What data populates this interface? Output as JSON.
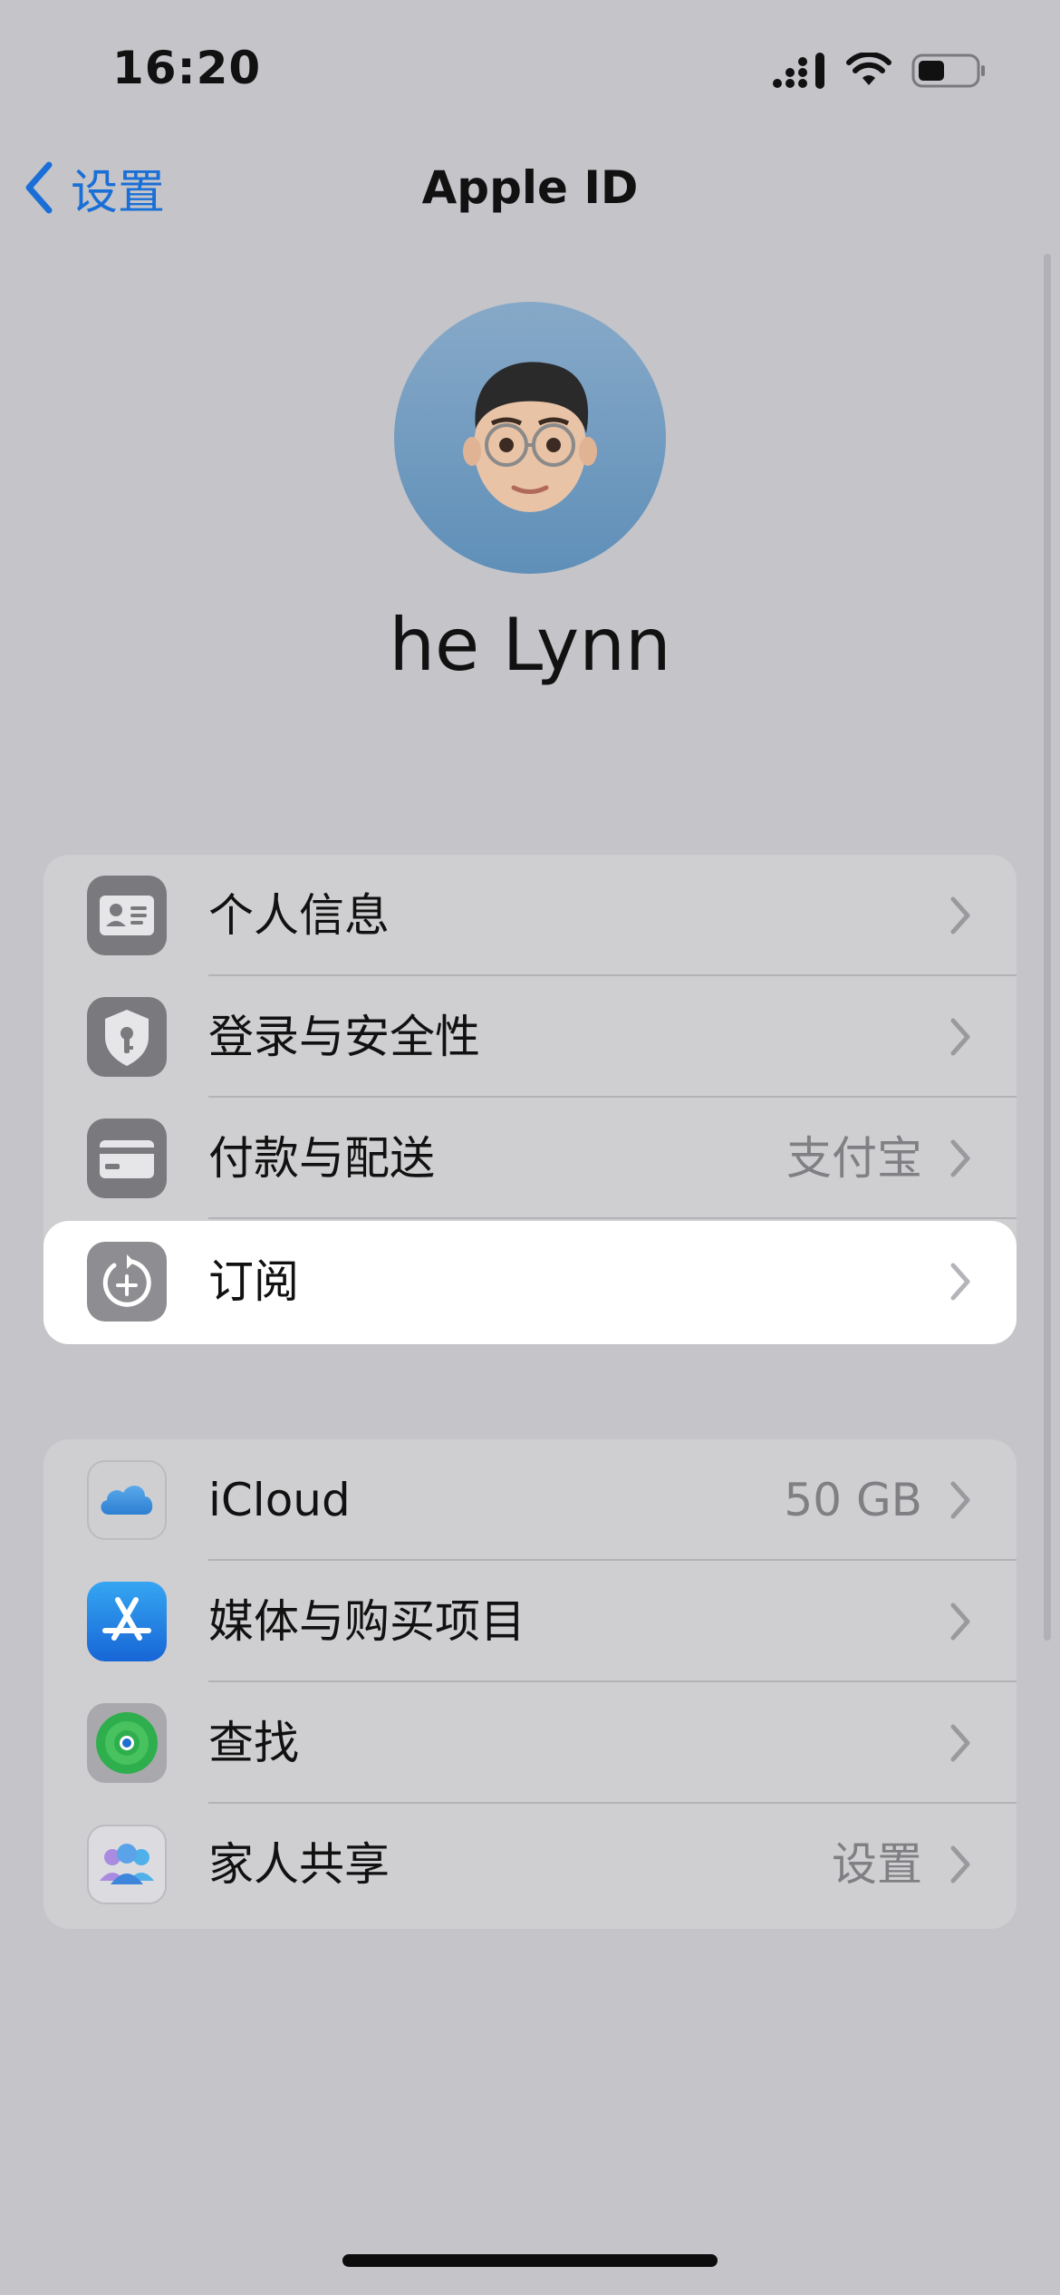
{
  "status_bar": {
    "time": "16:20",
    "icons": [
      "cellular-signal-icon",
      "wifi-icon",
      "battery-icon"
    ]
  },
  "nav": {
    "back_label": "设置",
    "title": "Apple ID"
  },
  "profile": {
    "name": "he Lynn"
  },
  "group1": {
    "rows": [
      {
        "label": "个人信息",
        "value": "",
        "icon": "contact-card-icon"
      },
      {
        "label": "登录与安全性",
        "value": "",
        "icon": "shield-key-icon"
      },
      {
        "label": "付款与配送",
        "value": "支付宝",
        "icon": "credit-card-icon"
      },
      {
        "label": "订阅",
        "value": "",
        "icon": "subscription-icon"
      }
    ]
  },
  "group2": {
    "rows": [
      {
        "label": "iCloud",
        "value": "50 GB",
        "icon": "icloud-icon"
      },
      {
        "label": "媒体与购买项目",
        "value": "",
        "icon": "app-store-icon"
      },
      {
        "label": "查找",
        "value": "",
        "icon": "find-my-icon"
      },
      {
        "label": "家人共享",
        "value": "设置",
        "icon": "family-sharing-icon"
      }
    ]
  },
  "colors": {
    "background": "#c4c4c9",
    "group_background": "#cfcfd1",
    "highlight": "#ffffff",
    "accent": "#1a6fd6",
    "secondary_text": "#808084"
  }
}
